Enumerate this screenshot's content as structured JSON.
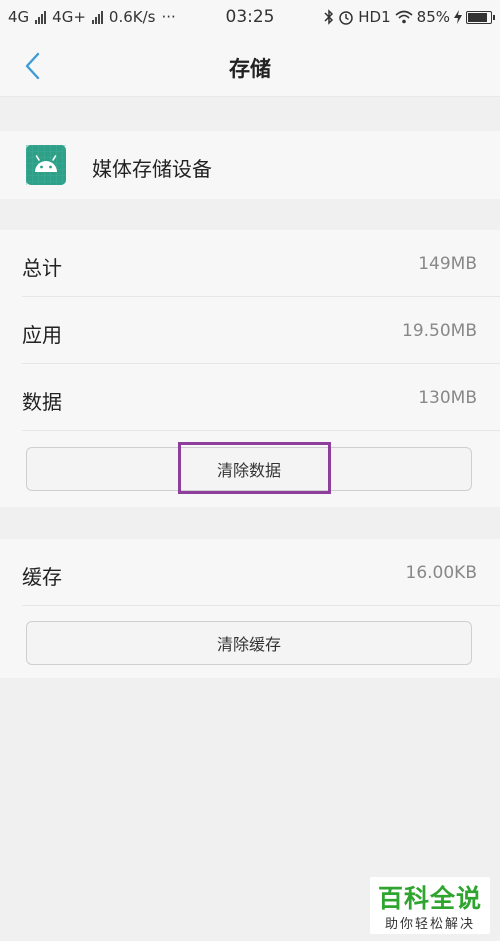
{
  "status_bar": {
    "net1": "4G",
    "net2": "4G+",
    "speed": "0.6K/s",
    "time": "03:25",
    "hd": "HD1",
    "battery": "85%"
  },
  "header": {
    "title": "存储"
  },
  "app": {
    "name": "媒体存储设备",
    "icon_color": "#2f9f88"
  },
  "storage": {
    "rows": [
      {
        "label": "总计",
        "value": "149MB"
      },
      {
        "label": "应用",
        "value": "19.50MB"
      },
      {
        "label": "数据",
        "value": "130MB"
      }
    ],
    "clear_data_label": "清除数据"
  },
  "cache": {
    "label": "缓存",
    "value": "16.00KB",
    "clear_cache_label": "清除缓存"
  },
  "watermark": {
    "main": "百科全说",
    "sub": "助你轻松解决"
  },
  "colors": {
    "accent": "#3e9bd6",
    "highlight": "#8e3f9c"
  }
}
